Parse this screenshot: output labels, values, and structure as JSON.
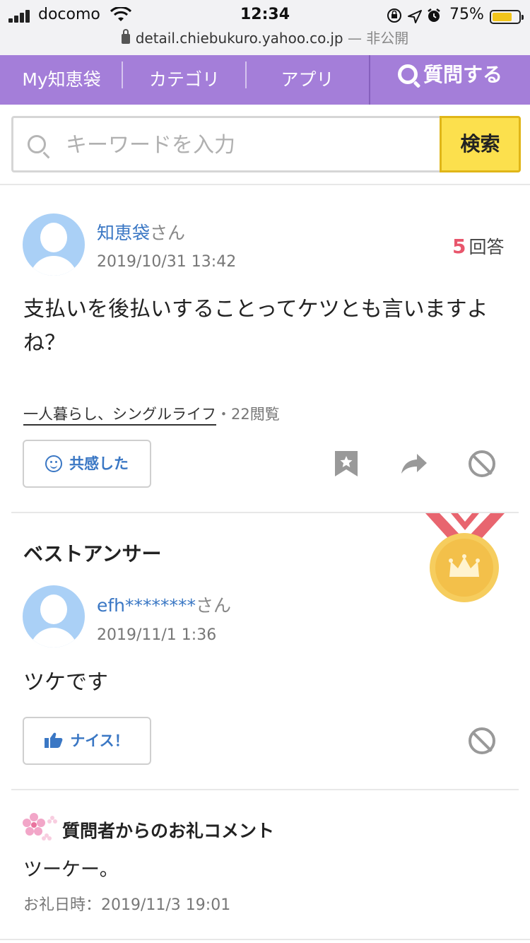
{
  "status_bar": {
    "carrier": "docomo",
    "time": "12:34",
    "battery_percent": "75%",
    "battery_level": 0.75,
    "url": "detail.chiebukuro.yahoo.co.jp",
    "private_label": "— 非公開"
  },
  "nav": {
    "my_chiebukuro": "My知恵袋",
    "category": "カテゴリ",
    "app": "アプリ",
    "ask": "質問する"
  },
  "search": {
    "placeholder": "キーワードを入力",
    "button_label": "検索"
  },
  "question": {
    "username": "知恵袋",
    "honorific": "さん",
    "date": "2019/10/31 13:42",
    "answer_count": "5",
    "answer_count_label": "回答",
    "text": "支払いを後払いすることってケツとも言いますよね？",
    "category_link": "一人暮らし、シングルライフ",
    "views": "・22閲覧",
    "empathy_button": "共感した"
  },
  "best_answer": {
    "heading": "ベストアンサー",
    "username": "efh********",
    "honorific": "さん",
    "date": "2019/11/1 1:36",
    "text": "ツケです",
    "nice_button": "ナイス！"
  },
  "thanks": {
    "heading": "質問者からのお礼コメント",
    "text": "ツーケー。",
    "date": "お礼日時：2019/11/3 19:01"
  },
  "colors": {
    "nav_purple": "#a47ed9",
    "link_blue": "#3a77c4",
    "search_yellow": "#fce04d",
    "count_red": "#e8566c"
  }
}
